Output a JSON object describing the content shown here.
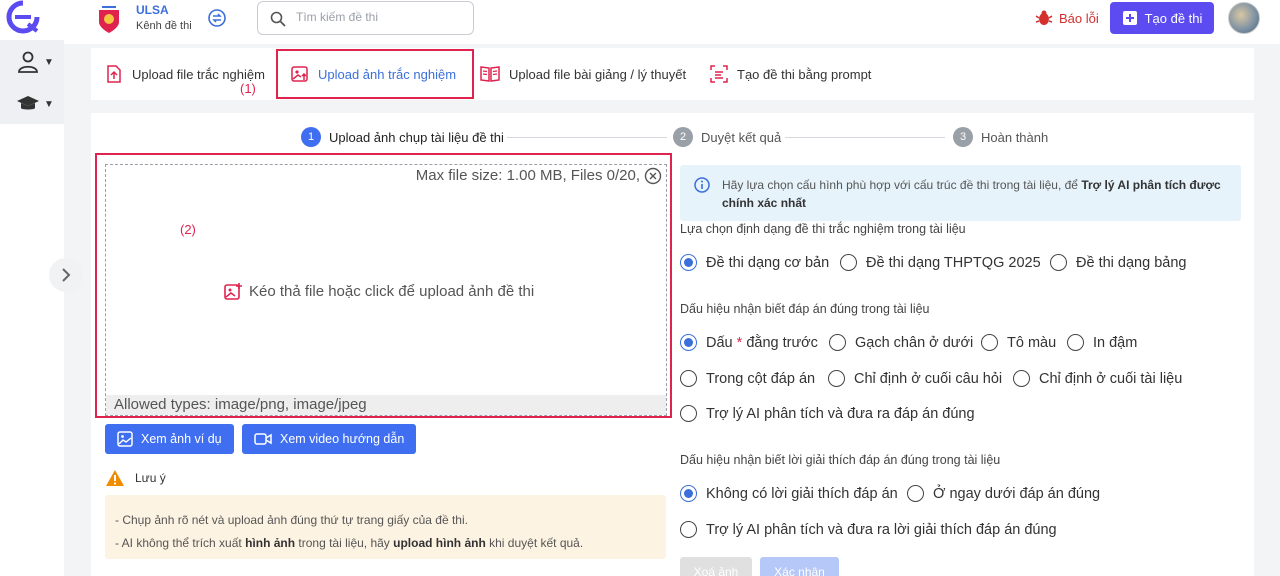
{
  "brand": {
    "name": "ULSA",
    "subtitle": "Kênh đề thi"
  },
  "search": {
    "placeholder": "Tìm kiếm đề thi"
  },
  "header": {
    "report_label": "Báo lỗi",
    "create_label": "Tạo đề thi"
  },
  "tabs": [
    {
      "label": "Upload file trắc nghiệm",
      "icon": "file-upload-icon"
    },
    {
      "label": "Upload ảnh trắc nghiệm",
      "icon": "image-upload-icon",
      "active": true
    },
    {
      "label": "Upload file bài giảng / lý thuyết",
      "icon": "book-icon"
    },
    {
      "label": "Tạo đề thi bằng prompt",
      "icon": "prompt-icon"
    }
  ],
  "annotations": {
    "one": "(1)",
    "two": "(2)"
  },
  "stepper": [
    {
      "num": "1",
      "label": "Upload ảnh chụp tài liệu đề thi",
      "active": true
    },
    {
      "num": "2",
      "label": "Duyệt kết quả"
    },
    {
      "num": "3",
      "label": "Hoàn thành"
    }
  ],
  "dropzone": {
    "max_info": "Max file size: 1.00 MB, Files 0/20,",
    "prompt": "Kéo thả file hoặc click để upload ảnh đề thi",
    "allowed": "Allowed types: image/png, image/jpeg"
  },
  "buttons": {
    "example_image": "Xem ảnh ví dụ",
    "video_guide": "Xem video hướng dẫn",
    "delete_image": "Xoá ảnh",
    "confirm": "Xác nhận"
  },
  "note": {
    "title": "Lưu ý",
    "line1": "- Chụp ảnh rõ nét và upload ảnh đúng thứ tự trang giấy của đề thi.",
    "line2_a": "- AI không thể trích xuất ",
    "line2_b": "hình ảnh",
    "line2_c": " trong tài liệu, hãy ",
    "line2_d": "upload hình ảnh",
    "line2_e": " khi duyệt kết quả."
  },
  "info": {
    "text_a": "Hãy lựa chọn cấu hình phù hợp với cấu trúc đề thi trong tài liệu, để ",
    "text_b": "Trợ lý AI phân tích được chính xác nhất"
  },
  "section_format": {
    "label": "Lựa chọn định dạng đề thi trắc nghiệm trong tài liệu",
    "options": [
      "Đề thi dạng cơ bản",
      "Đề thi dạng THPTQG 2025",
      "Đề thi dạng bảng"
    ],
    "selected": 0
  },
  "section_answer": {
    "label": "Dấu hiệu nhận biết đáp án đúng trong tài liệu",
    "options": [
      "Dấu",
      "đằng trước",
      "Gạch chân ở dưới",
      "Tô màu",
      "In đậm",
      "Trong cột đáp án",
      "Chỉ định ở cuối câu hỏi",
      "Chỉ định ở cuối tài liệu",
      "Trợ lý AI phân tích và đưa ra đáp án đúng"
    ],
    "star": "*",
    "selected": 0
  },
  "section_explain": {
    "label": "Dấu hiệu nhận biết lời giải thích đáp án đúng trong tài liệu",
    "options": [
      "Không có lời giải thích đáp án",
      "Ở ngay dưới đáp án đúng",
      "Trợ lý AI phân tích và đưa ra lời giải thích đáp án đúng"
    ],
    "selected": 0
  },
  "colors": {
    "primary": "#3f6ff0",
    "accent": "#5b4bf0",
    "highlight": "#e0234e",
    "error": "#d32f2f"
  }
}
